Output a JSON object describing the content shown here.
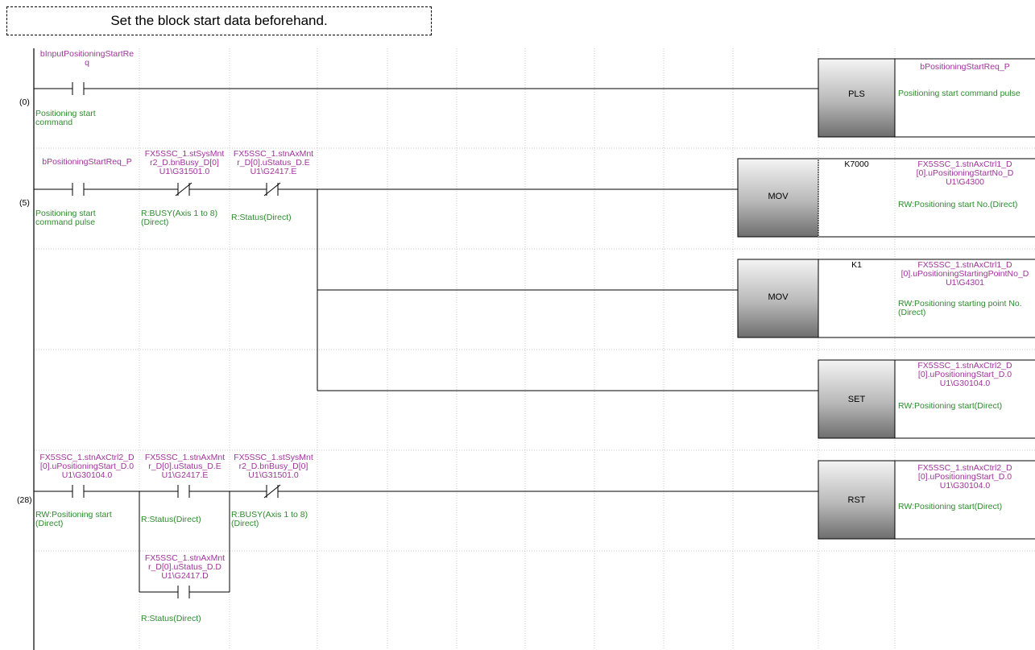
{
  "note": "Set the block start data beforehand.",
  "steps": [
    "(0)",
    "(5)",
    "(28)"
  ],
  "rung0": {
    "contact1_device": "bInputPositioningStartRe\nq",
    "contact1_comment": "Positioning start\ncommand",
    "instruction": "PLS",
    "coil_device": "bPositioningStartReq_P",
    "coil_comment": "Positioning start command pulse"
  },
  "rung5": {
    "contact1_device": "bPositioningStartReq_P",
    "contact1_comment": "Positioning start\ncommand pulse",
    "contact2_device": "FX5SSC_1.stSysMnt\nr2_D.bnBusy_D[0]\nU1\\G31501.0",
    "contact2_comment": "R:BUSY(Axis 1 to 8)\n(Direct)",
    "contact3_device": "FX5SSC_1.stnAxMnt\nr_D[0].uStatus_D.E\nU1\\G2417.E",
    "contact3_comment": "R:Status(Direct)",
    "mov1_instruction": "MOV",
    "mov1_source": "K7000",
    "mov1_dest": "FX5SSC_1.stnAxCtrl1_D\n[0].uPositioningStartNo_D\nU1\\G4300",
    "mov1_comment": "RW:Positioning start No.(Direct)",
    "mov2_instruction": "MOV",
    "mov2_source": "K1",
    "mov2_dest": "FX5SSC_1.stnAxCtrl1_D\n[0].uPositioningStartingPointNo_D\nU1\\G4301",
    "mov2_comment": "RW:Positioning starting point No.\n(Direct)",
    "set_instruction": "SET",
    "set_dest": "FX5SSC_1.stnAxCtrl2_D\n[0].uPositioningStart_D.0\nU1\\G30104.0",
    "set_comment": "RW:Positioning start(Direct)"
  },
  "rung28": {
    "contact1_device": "FX5SSC_1.stnAxCtrl2_D\n[0].uPositioningStart_D.0\nU1\\G30104.0",
    "contact1_comment": "RW:Positioning start\n(Direct)",
    "contact2_device": "FX5SSC_1.stnAxMnt\nr_D[0].uStatus_D.E\nU1\\G2417.E",
    "contact2_comment": "R:Status(Direct)",
    "contact3_device": "FX5SSC_1.stSysMnt\nr2_D.bnBusy_D[0]\nU1\\G31501.0",
    "contact3_comment": "R:BUSY(Axis 1 to 8)\n(Direct)",
    "contact4_device": "FX5SSC_1.stnAxMnt\nr_D[0].uStatus_D.D\nU1\\G2417.D",
    "contact4_comment": "R:Status(Direct)",
    "rst_instruction": "RST",
    "rst_dest": "FX5SSC_1.stnAxCtrl2_D\n[0].uPositioningStart_D.0\nU1\\G30104.0",
    "rst_comment": "RW:Positioning start(Direct)"
  }
}
